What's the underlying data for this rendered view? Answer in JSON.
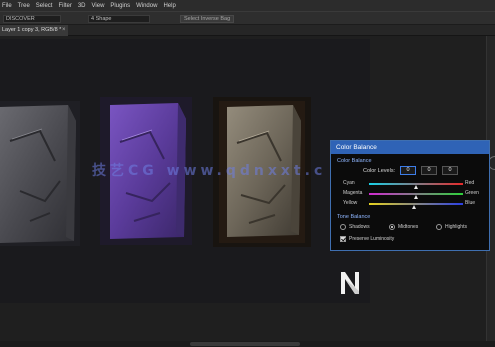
{
  "menubar": {
    "items": [
      "File",
      "Tree",
      "Select",
      "Filter",
      "3D",
      "View",
      "Plugins",
      "Window",
      "Help"
    ]
  },
  "options": {
    "mode_value": "DISCOVER",
    "preset_value": "4  Shape",
    "button_label": "Select Inverse Bag"
  },
  "document": {
    "tab_title": "Layer 1 copy 3, RGB/8 *",
    "close_glyph": "×"
  },
  "watermark": {
    "text": "技艺CG  www.qdnxxt.c"
  },
  "color_balance": {
    "title": "Color Balance",
    "section_balance": "Color Balance",
    "levels_label": "Color Levels:",
    "levels": [
      "0",
      "0",
      "0"
    ],
    "sliders": [
      {
        "left": "Cyan",
        "right": "Red",
        "value": 0,
        "gradient": [
          "#19d0e6",
          "#e62a2a"
        ]
      },
      {
        "left": "Magenta",
        "right": "Green",
        "value": 0,
        "gradient": [
          "#d22bd2",
          "#2ed23a"
        ]
      },
      {
        "left": "Yellow",
        "right": "Blue",
        "value": -5,
        "gradient": [
          "#e6d21f",
          "#2a3fe6"
        ]
      }
    ],
    "slider_range": [
      -100,
      100
    ],
    "section_tone": "Tone Balance",
    "tones": [
      {
        "label": "Shadows",
        "selected": false
      },
      {
        "label": "Midtones",
        "selected": true
      },
      {
        "label": "Highlights",
        "selected": false
      }
    ],
    "preserve_label": "Preserve Luminosity",
    "preserve_checked": true
  },
  "colors": {
    "accent": "#2f63b6",
    "tile_gray": "#4a4a4f",
    "tile_purple": "#5a3b9a",
    "tile_tan": "#6d6659"
  },
  "icons": {
    "logo": "n-logo-icon",
    "panel_collapse": "panel-collapse-icon"
  }
}
